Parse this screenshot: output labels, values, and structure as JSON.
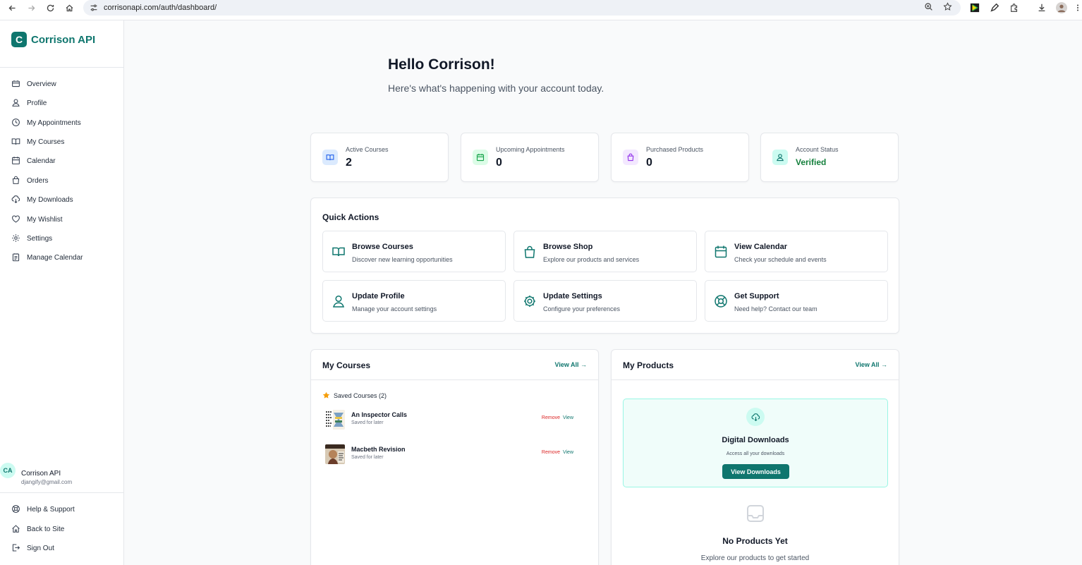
{
  "browser": {
    "url": "corrisonapi.com/auth/dashboard/"
  },
  "brand": {
    "logo_letter": "C",
    "name": "Corrison API"
  },
  "sidebar": {
    "items": [
      {
        "label": "Overview",
        "icon": "overview-icon"
      },
      {
        "label": "Profile",
        "icon": "user-icon"
      },
      {
        "label": "My Appointments",
        "icon": "clock-icon"
      },
      {
        "label": "My Courses",
        "icon": "book-icon"
      },
      {
        "label": "Calendar",
        "icon": "calendar-icon"
      },
      {
        "label": "Orders",
        "icon": "bag-icon"
      },
      {
        "label": "My Downloads",
        "icon": "download-cloud-icon"
      },
      {
        "label": "My Wishlist",
        "icon": "heart-icon"
      },
      {
        "label": "Settings",
        "icon": "gear-icon"
      },
      {
        "label": "Manage Calendar",
        "icon": "calendar-manage-icon"
      }
    ],
    "user": {
      "initials": "CA",
      "name": "Corrison API",
      "email": "djangify@gmail.com"
    },
    "footer": [
      {
        "label": "Help & Support",
        "icon": "lifebuoy-icon"
      },
      {
        "label": "Back to Site",
        "icon": "home-icon"
      },
      {
        "label": "Sign Out",
        "icon": "sign-out-icon"
      }
    ]
  },
  "header": {
    "greeting": "Hello Corrison!",
    "subtitle": "Here's what's happening with your account today."
  },
  "stats": [
    {
      "label": "Active Courses",
      "value": "2",
      "icon": "book-icon",
      "color": "#2563eb"
    },
    {
      "label": "Upcoming Appointments",
      "value": "0",
      "icon": "calendar-icon",
      "color": "#16a34a"
    },
    {
      "label": "Purchased Products",
      "value": "0",
      "icon": "bag-icon",
      "color": "#9333ea"
    },
    {
      "label": "Account Status",
      "value": "Verified",
      "icon": "user-icon",
      "color": "#0f766e"
    }
  ],
  "quick_actions": {
    "title": "Quick Actions",
    "items": [
      {
        "title": "Browse Courses",
        "desc": "Discover new learning opportunities",
        "icon": "book-open-icon"
      },
      {
        "title": "Browse Shop",
        "desc": "Explore our products and services",
        "icon": "shopping-bag-icon"
      },
      {
        "title": "View Calendar",
        "desc": "Check your schedule and events",
        "icon": "calendar-icon"
      },
      {
        "title": "Update Profile",
        "desc": "Manage your account settings",
        "icon": "user-icon"
      },
      {
        "title": "Update Settings",
        "desc": "Configure your preferences",
        "icon": "gear-icon"
      },
      {
        "title": "Get Support",
        "desc": "Need help? Contact our team",
        "icon": "lifebuoy-icon"
      }
    ]
  },
  "my_courses": {
    "title": "My Courses",
    "view_all": "View All →",
    "saved_header": "Saved Courses (2)",
    "items": [
      {
        "name": "An Inspector Calls",
        "sub": "Saved for later",
        "remove": "Remove",
        "view": "View"
      },
      {
        "name": "Macbeth Revision",
        "sub": "Saved for later",
        "remove": "Remove",
        "view": "View"
      }
    ]
  },
  "my_products": {
    "title": "My Products",
    "view_all": "View All →",
    "downloads_title": "Digital Downloads",
    "downloads_sub": "Access all your downloads",
    "downloads_button": "View Downloads",
    "empty_title": "No Products Yet",
    "empty_sub": "Explore our products to get started"
  },
  "colors": {
    "accent": "#0f766e",
    "danger": "#dc2626"
  }
}
